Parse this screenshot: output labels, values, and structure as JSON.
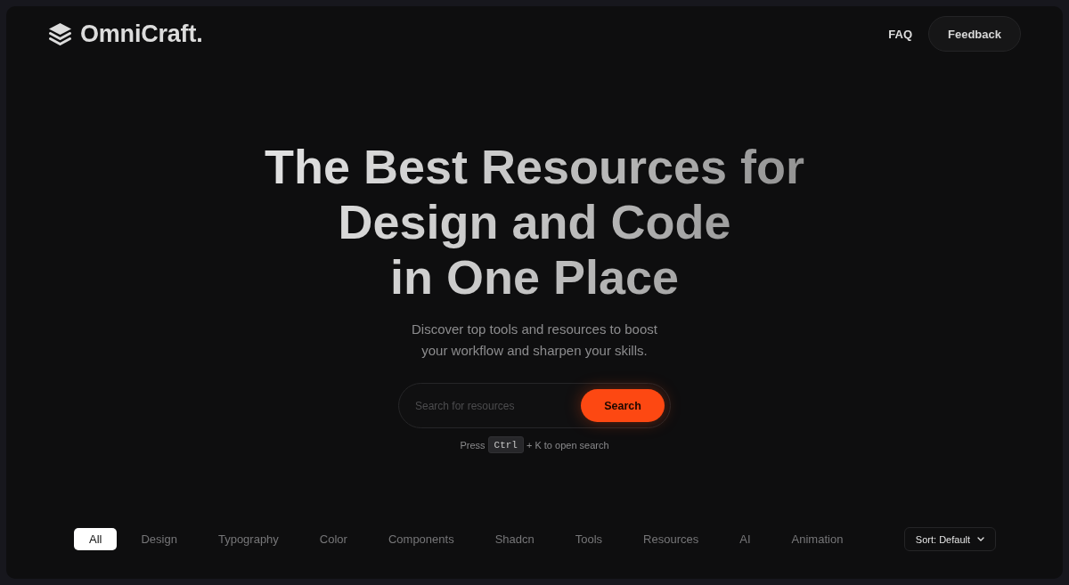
{
  "brand": {
    "name": "OmniCraft."
  },
  "nav": [
    {
      "kind": "link",
      "label": "FAQ"
    },
    {
      "kind": "button",
      "label": "Feedback"
    }
  ],
  "hero": {
    "heading": "The Best Resources for\nDesign and Code\nin One Place",
    "subtitle": "Discover top tools and resources to boost\nyour workflow and sharpen your skills.",
    "search": {
      "placeholder": "Search for resources",
      "button": "Search"
    },
    "shortcut_hint": {
      "before": "Press",
      "key": "Ctrl",
      "after": "+ K to open search"
    }
  },
  "filters": [
    {
      "label": "All",
      "selected": true
    },
    {
      "label": "Design",
      "selected": false
    },
    {
      "label": "Typography",
      "selected": false
    },
    {
      "label": "Color",
      "selected": false
    },
    {
      "label": "Components",
      "selected": false
    },
    {
      "label": "Shadcn",
      "selected": false
    },
    {
      "label": "Tools",
      "selected": false
    },
    {
      "label": "Resources",
      "selected": false
    },
    {
      "label": "AI",
      "selected": false
    },
    {
      "label": "Animation",
      "selected": false
    }
  ],
  "sort": {
    "label": "Sort: Default"
  }
}
